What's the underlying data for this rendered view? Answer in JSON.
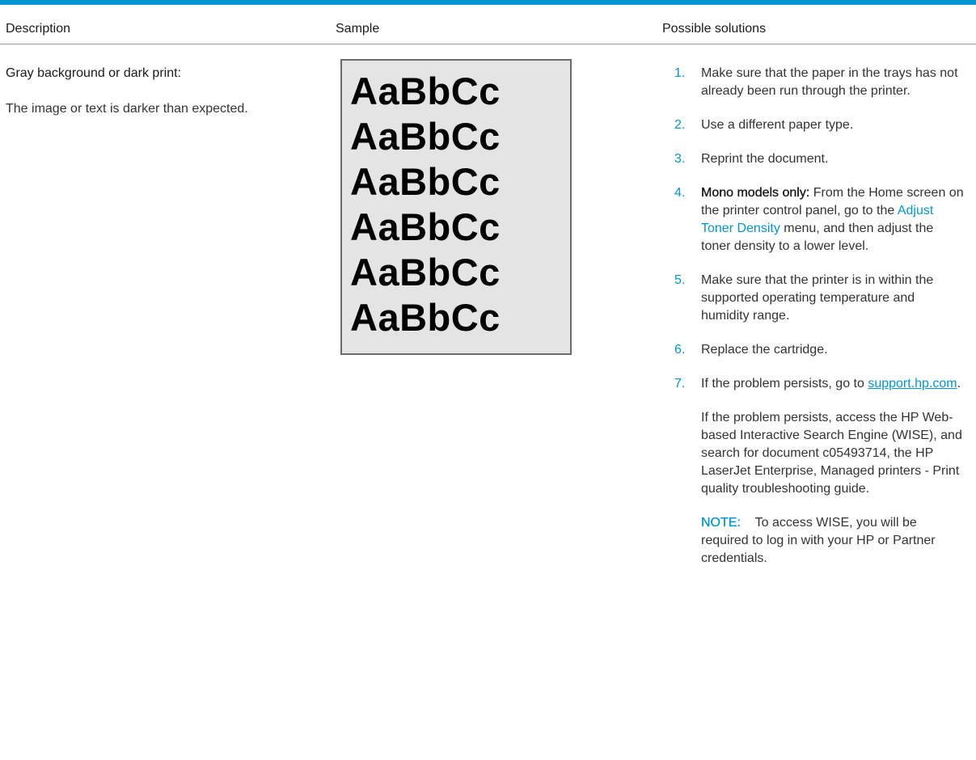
{
  "header": {
    "description": "Description",
    "sample": "Sample",
    "solutions": "Possible solutions"
  },
  "description": {
    "title": "Gray background or dark print:",
    "text": "The image or text is darker than expected."
  },
  "sample": {
    "lines": [
      "AaBbCc",
      "AaBbCc",
      "AaBbCc",
      "AaBbCc",
      "AaBbCc",
      "AaBbCc"
    ]
  },
  "solutions": [
    {
      "num": "1.",
      "text": "Make sure that the paper in the trays has not already been run through the printer."
    },
    {
      "num": "2.",
      "text": "Use a different paper type."
    },
    {
      "num": "3.",
      "text": "Reprint the document."
    },
    {
      "num": "4.",
      "lead": "Mono models only:",
      "text_a": " From the Home screen on the printer control panel, go to the ",
      "link": "Adjust Toner Density",
      "text_b": " menu, and then adjust the toner density to a lower level."
    },
    {
      "num": "5.",
      "text": "Make sure that the printer is in within the supported operating temperature and humidity range."
    },
    {
      "num": "6.",
      "text": "Replace the cartridge."
    },
    {
      "num": "7.",
      "text": "If the problem persists, go to ",
      "link": "support.hp.com",
      "text_end": ".",
      "sub_text": "If the problem persists, access the HP Web-based Interactive Search Engine (WISE), and search for document c05493714, the HP LaserJet Enterprise, Managed printers - Print quality troubleshooting guide.",
      "note_label": "NOTE:",
      "note_text": "To access WISE, you will be required to log in with your HP or Partner credentials."
    }
  ],
  "colors": {
    "accent": "#0096d6",
    "sample_bg": "#e4e4e4"
  }
}
